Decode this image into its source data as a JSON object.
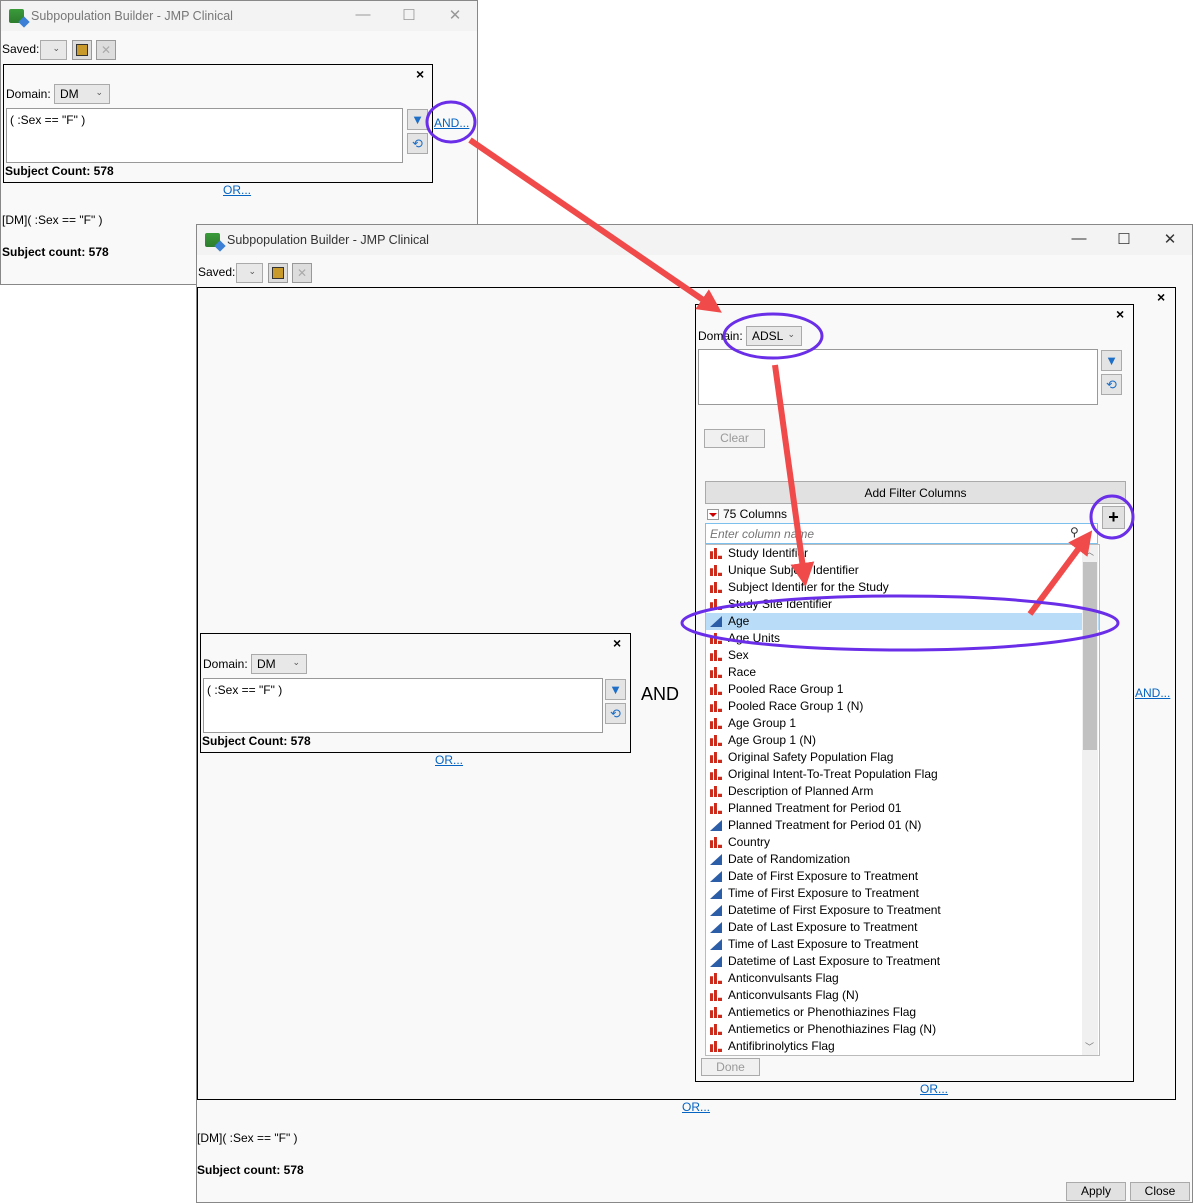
{
  "window1": {
    "title": "Subpopulation Builder - JMP Clinical",
    "saved_label": "Saved:",
    "domain_label": "Domain:",
    "domain_value": "DM",
    "expression": "( :Sex == \"F\" )",
    "subject_count": "Subject Count: 578",
    "and_link": "AND...",
    "or_link": "OR...",
    "summary_expr": "[DM]( :Sex == \"F\" )",
    "summary_count": "Subject count: 578"
  },
  "window2": {
    "title": "Subpopulation Builder - JMP Clinical",
    "saved_label": "Saved:",
    "left_box": {
      "domain_label": "Domain:",
      "domain_value": "DM",
      "expression": "( :Sex == \"F\" )",
      "subject_count": "Subject Count: 578",
      "or_link": "OR..."
    },
    "and_label": "AND",
    "right_box": {
      "domain_label": "Domain:",
      "domain_value": "ADSL",
      "expression": "",
      "clear_button": "Clear",
      "add_filter_columns": "Add Filter Columns",
      "columns_count": "75 Columns",
      "search_placeholder": "Enter column name",
      "done_button": "Done",
      "or_link": "OR...",
      "selected": "Age",
      "columns": [
        {
          "name": "Study Identifier",
          "type": "nominal"
        },
        {
          "name": "Unique Subject Identifier",
          "type": "nominal"
        },
        {
          "name": "Subject Identifier for the Study",
          "type": "nominal"
        },
        {
          "name": "Study Site Identifier",
          "type": "nominal"
        },
        {
          "name": "Age",
          "type": "continuous"
        },
        {
          "name": "Age Units",
          "type": "nominal"
        },
        {
          "name": "Sex",
          "type": "nominal"
        },
        {
          "name": "Race",
          "type": "nominal"
        },
        {
          "name": "Pooled Race Group 1",
          "type": "nominal"
        },
        {
          "name": "Pooled Race Group 1 (N)",
          "type": "nominal"
        },
        {
          "name": "Age Group 1",
          "type": "nominal"
        },
        {
          "name": "Age Group 1 (N)",
          "type": "nominal"
        },
        {
          "name": "Original Safety Population Flag",
          "type": "nominal"
        },
        {
          "name": "Original Intent-To-Treat Population Flag",
          "type": "nominal"
        },
        {
          "name": "Description of Planned Arm",
          "type": "nominal"
        },
        {
          "name": "Planned Treatment for Period 01",
          "type": "nominal"
        },
        {
          "name": "Planned Treatment for Period 01 (N)",
          "type": "continuous"
        },
        {
          "name": "Country",
          "type": "nominal"
        },
        {
          "name": "Date of Randomization",
          "type": "continuous"
        },
        {
          "name": "Date of First Exposure to Treatment",
          "type": "continuous"
        },
        {
          "name": "Time of First Exposure to Treatment",
          "type": "continuous"
        },
        {
          "name": "Datetime of First Exposure to Treatment",
          "type": "continuous"
        },
        {
          "name": "Date of Last Exposure to Treatment",
          "type": "continuous"
        },
        {
          "name": "Time of Last Exposure to Treatment",
          "type": "continuous"
        },
        {
          "name": "Datetime of Last Exposure to Treatment",
          "type": "continuous"
        },
        {
          "name": "Anticonvulsants Flag",
          "type": "nominal"
        },
        {
          "name": "Anticonvulsants Flag (N)",
          "type": "nominal"
        },
        {
          "name": "Antiemetics or Phenothiazines Flag",
          "type": "nominal"
        },
        {
          "name": "Antiemetics or Phenothiazines Flag (N)",
          "type": "nominal"
        },
        {
          "name": "Antifibrinolytics Flag",
          "type": "nominal"
        }
      ]
    },
    "and_link": "AND...",
    "or_link": "OR...",
    "summary_expr": "[DM]( :Sex == \"F\" )",
    "summary_count": "Subject count: 578",
    "apply_button": "Apply",
    "close_button": "Close"
  },
  "colors": {
    "annotation_arrow": "#f04a4a",
    "annotation_circle": "#6a2ee8",
    "link": "#0563c1",
    "selection": "#b9dcf8"
  }
}
